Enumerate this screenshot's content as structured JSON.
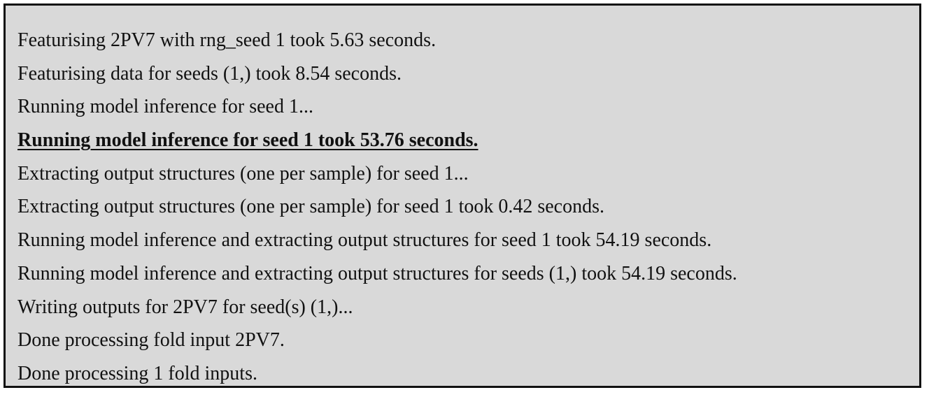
{
  "log": {
    "lines": [
      {
        "text": "Featurising 2PV7 with rng_seed 1 took 5.63 seconds.",
        "highlight": false
      },
      {
        "text": "Featurising data for seeds (1,) took 8.54 seconds.",
        "highlight": false
      },
      {
        "text": "Running model inference for seed 1...",
        "highlight": false
      },
      {
        "text": "Running model inference for seed 1 took 53.76 seconds.",
        "highlight": true
      },
      {
        "text": "Extracting output structures (one per sample) for seed 1...",
        "highlight": false
      },
      {
        "text": "Extracting output structures (one per sample) for seed 1 took 0.42 seconds.",
        "highlight": false
      },
      {
        "text": "Running model inference and extracting output structures for seed 1 took 54.19 seconds.",
        "highlight": false
      },
      {
        "text": "Running model inference and extracting output structures for seeds (1,) took 54.19 seconds.",
        "highlight": false
      },
      {
        "text": "Writing outputs for 2PV7 for seed(s) (1,)...",
        "highlight": false
      },
      {
        "text": "Done processing fold input 2PV7.",
        "highlight": false
      },
      {
        "text": "Done processing 1 fold inputs.",
        "highlight": false
      }
    ]
  },
  "colors": {
    "background": "#d9d9d9",
    "border": "#111111",
    "text": "#111111"
  }
}
